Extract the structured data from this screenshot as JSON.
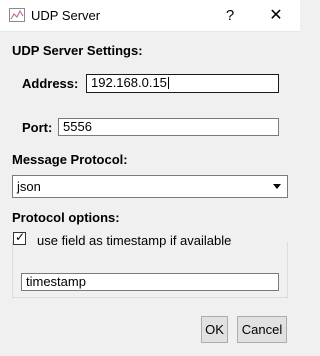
{
  "window": {
    "title": "UDP Server",
    "help_label": "?",
    "close_label": "✕"
  },
  "settings": {
    "heading": "UDP Server Settings:",
    "address_label": "Address:",
    "address_value": "192.168.0.15",
    "port_label": "Port:",
    "port_value": "5556"
  },
  "message_protocol": {
    "heading": "Message Protocol:",
    "selected": "json"
  },
  "protocol_options": {
    "heading": "Protocol options:",
    "checkbox_label": "use field as timestamp if available",
    "checkbox_checked": true,
    "checkbox_mark": "✓",
    "timestamp_field_value": "timestamp"
  },
  "buttons": {
    "ok_label": "OK",
    "cancel_label": "Cancel"
  }
}
